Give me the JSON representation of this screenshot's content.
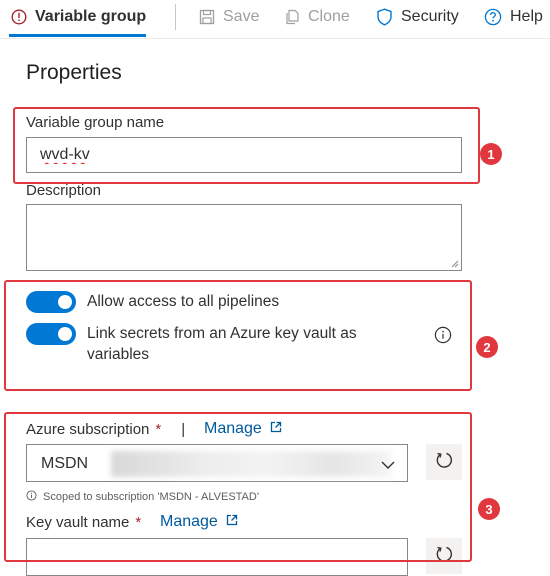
{
  "toolbar": {
    "tab_variable_group": "Variable group",
    "save": "Save",
    "clone": "Clone",
    "security": "Security",
    "help": "Help"
  },
  "properties": {
    "heading": "Properties",
    "name_label": "Variable group name",
    "name_value": "wvd-kv",
    "description_label": "Description",
    "description_value": ""
  },
  "toggles": {
    "allow_access": "Allow access to all pipelines",
    "link_secrets_line1": "Link secrets from an Azure key vault as",
    "link_secrets_line2": "variables"
  },
  "azure": {
    "subscription_label": "Azure subscription",
    "required_mark": "*",
    "separator": "|",
    "manage_label": "Manage",
    "subscription_value": "MSDN",
    "scope_note": "Scoped to subscription 'MSDN - ALVESTAD'",
    "keyvault_label": "Key vault name",
    "keyvault_manage_label": "Manage"
  },
  "badges": {
    "one": "1",
    "two": "2",
    "three": "3"
  },
  "colors": {
    "accent": "#0078d4",
    "annotation_red": "#e0383e",
    "link": "#005a9e"
  }
}
